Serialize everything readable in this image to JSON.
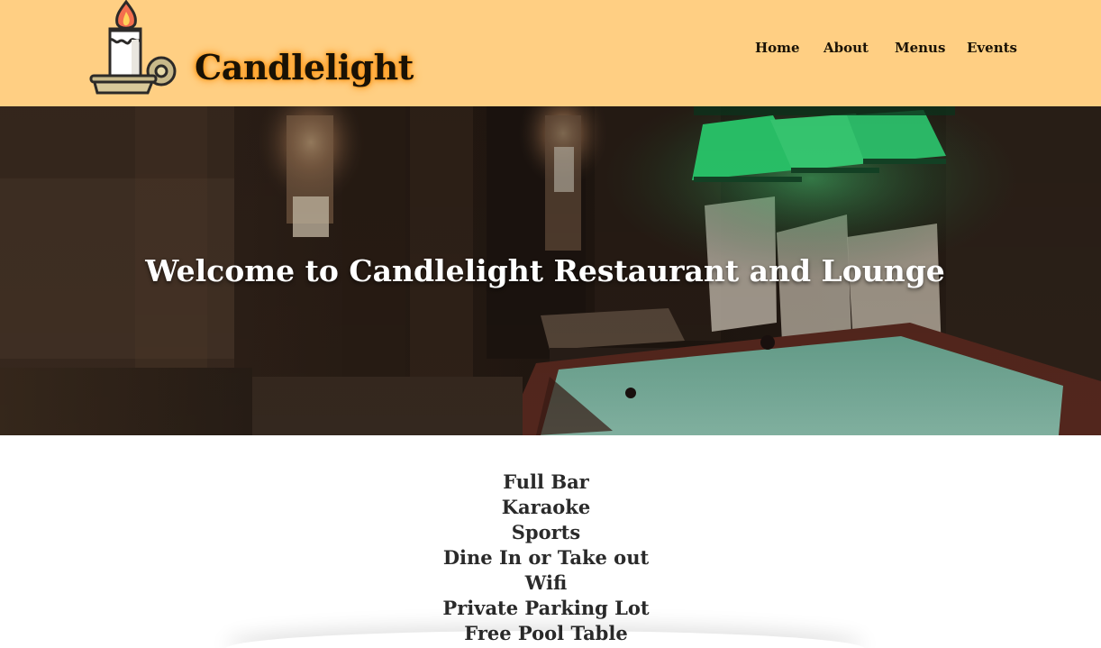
{
  "header": {
    "logo_text": "Candlelight",
    "logo_icon": "candle-holder-icon",
    "nav": [
      {
        "label": "Home"
      },
      {
        "label": "About"
      },
      {
        "label": "Menus"
      },
      {
        "label": "Events"
      }
    ],
    "background_color": "#ffcf83"
  },
  "hero": {
    "title": "Welcome to Candlelight Restaurant and Lounge",
    "image": "pool-room-photo"
  },
  "features": [
    "Full Bar",
    "Karaoke",
    "Sports",
    "Dine In or Take out",
    "Wifi",
    "Private Parking Lot",
    "Free Pool Table"
  ]
}
